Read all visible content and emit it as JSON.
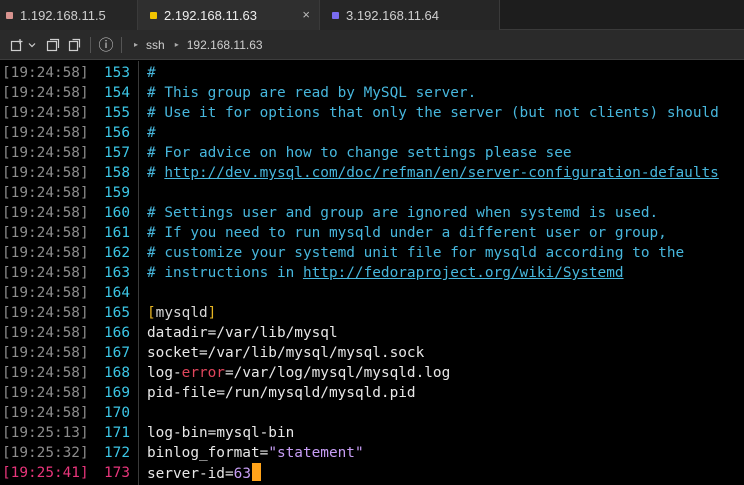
{
  "tabs": [
    {
      "label": "1.192.168.11.5",
      "color": "#d7928e",
      "active": false
    },
    {
      "label": "2.192.168.11.63",
      "color": "#f2c400",
      "active": true
    },
    {
      "label": "3.192.168.11.64",
      "color": "#7a6cf0",
      "active": false
    }
  ],
  "tab_close_icon": "×",
  "toolbar": {
    "info_icon": "ⓘ",
    "breadcrumb": [
      "ssh",
      "192.168.11.63"
    ]
  },
  "lines": [
    {
      "ts": "[19:24:58]",
      "ln": "153",
      "t": "#"
    },
    {
      "ts": "[19:24:58]",
      "ln": "154",
      "t": "# This group are read by MySQL server."
    },
    {
      "ts": "[19:24:58]",
      "ln": "155",
      "t": "# Use it for options that only the server (but not clients) should"
    },
    {
      "ts": "[19:24:58]",
      "ln": "156",
      "t": "#"
    },
    {
      "ts": "[19:24:58]",
      "ln": "157",
      "t": "# For advice on how to change settings please see"
    },
    {
      "ts": "[19:24:58]",
      "ln": "158",
      "t": "# ",
      "url": "http://dev.mysql.com/doc/refman/en/server-configuration-defaults"
    },
    {
      "ts": "[19:24:58]",
      "ln": "159",
      "t": ""
    },
    {
      "ts": "[19:24:58]",
      "ln": "160",
      "t": "# Settings user and group are ignored when systemd is used."
    },
    {
      "ts": "[19:24:58]",
      "ln": "161",
      "t": "# If you need to run mysqld under a different user or group,"
    },
    {
      "ts": "[19:24:58]",
      "ln": "162",
      "t": "# customize your systemd unit file for mysqld according to the"
    },
    {
      "ts": "[19:24:58]",
      "ln": "163",
      "t": "# instructions in ",
      "url": "http://fedoraproject.org/wiki/Systemd"
    },
    {
      "ts": "[19:24:58]",
      "ln": "164",
      "t": ""
    },
    {
      "ts": "[19:24:58]",
      "ln": "165",
      "section": "mysqld"
    },
    {
      "ts": "[19:24:58]",
      "ln": "166",
      "k": "datadir",
      "v": "/var/lib/mysql"
    },
    {
      "ts": "[19:24:58]",
      "ln": "167",
      "k": "socket",
      "v": "/var/lib/mysql/mysql.sock"
    },
    {
      "ts": "[19:24:58]",
      "ln": "168",
      "k": "log-",
      "kerr": "error",
      "v": "/var/log/mysql/mysqld.log"
    },
    {
      "ts": "[19:24:58]",
      "ln": "169",
      "k": "pid-file",
      "v": "/run/mysqld/mysqld.pid"
    },
    {
      "ts": "[19:24:58]",
      "ln": "170",
      "t": ""
    },
    {
      "ts": "[19:25:13]",
      "ln": "171",
      "k": "log-bin",
      "v": "mysql-bin"
    },
    {
      "ts": "[19:25:32]",
      "ln": "172",
      "k": "binlog_format",
      "vstr": "\"statement\""
    },
    {
      "ts": "[19:25:41]",
      "ln": "173",
      "k": "server-id",
      "vnum": "63",
      "current": true
    }
  ]
}
